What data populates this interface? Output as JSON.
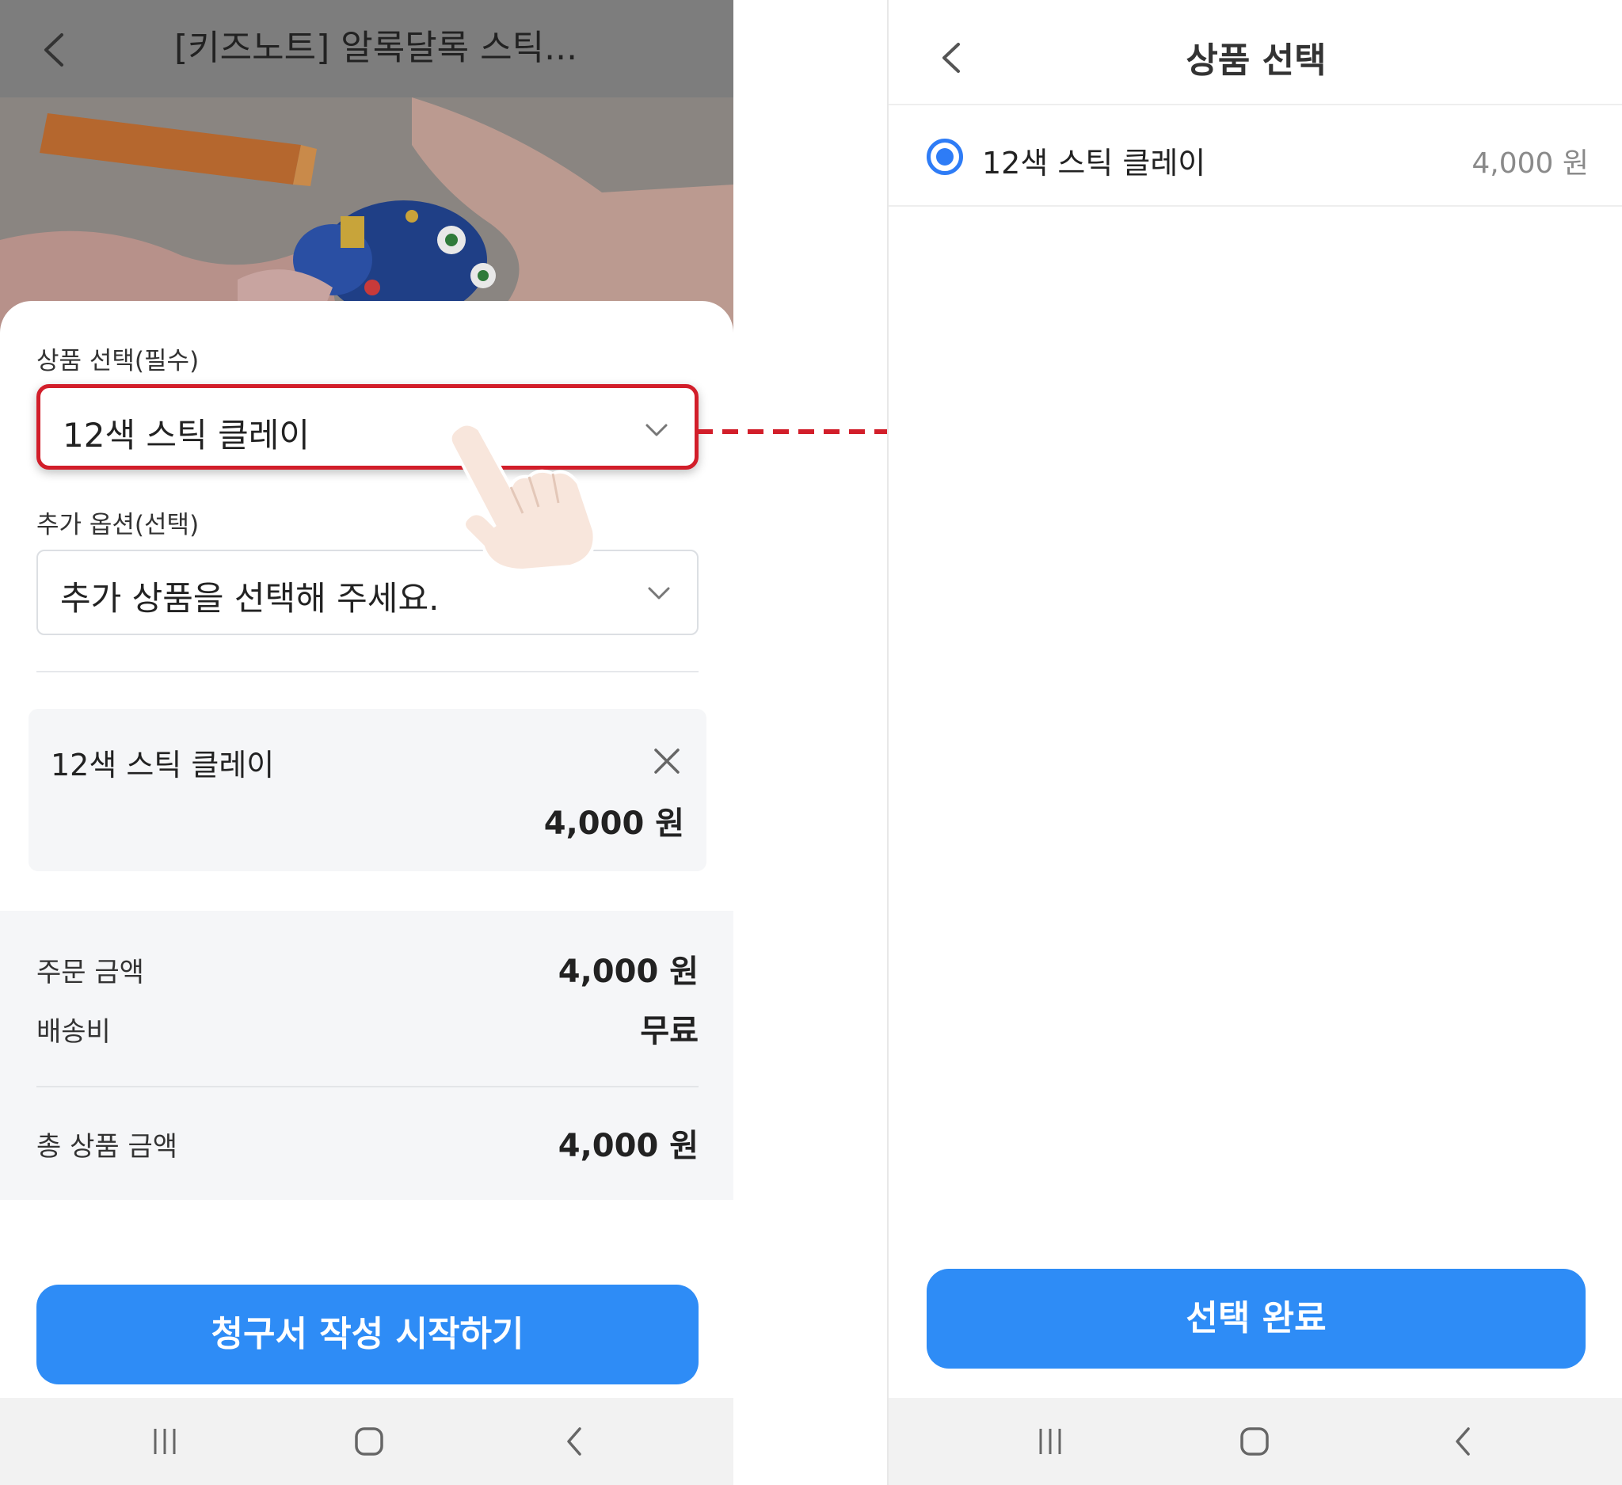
{
  "left": {
    "header_title": "[키즈노트] 알록달록 스틱...",
    "product_label": "상품 선택(필수)",
    "product_value": "12색 스틱 클레이",
    "option_label": "추가 옵션(선택)",
    "option_placeholder": "추가 상품을 선택해 주세요.",
    "item": {
      "name": "12색 스틱 클레이",
      "price": "4,000 원"
    },
    "summary": {
      "order_label": "주문 금액",
      "order_value": "4,000 원",
      "shipping_label": "배송비",
      "shipping_value": "무료",
      "total_label": "총 상품 금액",
      "total_value": "4,000 원"
    },
    "cta": "청구서 작성 시작하기"
  },
  "right": {
    "title": "상품 선택",
    "option": {
      "name": "12색 스틱 클레이",
      "price": "4,000 원",
      "selected": true
    },
    "cta": "선택 완료"
  },
  "colors": {
    "accent": "#2e8cf6",
    "highlight": "#d21e2a",
    "radio": "#2e7cf6"
  }
}
